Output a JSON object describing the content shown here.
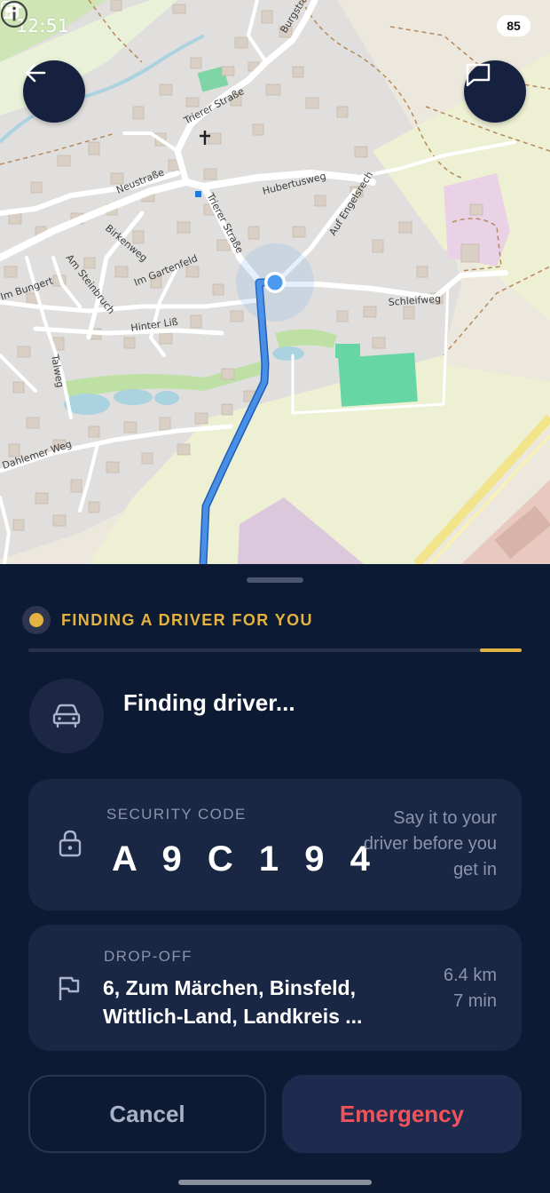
{
  "status_bar": {
    "time": "12:51",
    "battery": "85"
  },
  "map": {
    "street_labels": [
      "Burgstraße",
      "Trierer Straße",
      "Neustraße",
      "Hubertusweg",
      "Auf Engelsrech",
      "Birkenweg",
      "Im Gartenfeld",
      "Am Steinbruch",
      "Im Bungert",
      "Hinter Liß",
      "Schleifweg",
      "Talweg",
      "Dahlemer Weg"
    ]
  },
  "sheet": {
    "status_text": "FINDING A DRIVER FOR YOU",
    "progress_fraction": 0.085,
    "driver_text": "Finding driver...",
    "security": {
      "label": "SECURITY CODE",
      "code": "A 9 C 1 9 4",
      "hint": "Say it to your driver before you get in"
    },
    "dropoff": {
      "label": "DROP-OFF",
      "address_line1": "6, Zum Märchen, Binsfeld,",
      "address_line2": "Wittlich-Land, Landkreis ...",
      "distance": "6.4 km",
      "duration": "7 min"
    },
    "buttons": {
      "cancel": "Cancel",
      "emergency": "Emergency"
    }
  },
  "colors": {
    "accent": "#e3b341",
    "sheet_bg": "#0d1a33",
    "card_bg": "#1a2744",
    "emergency": "#f0535b",
    "route": "#4a8fe6"
  }
}
